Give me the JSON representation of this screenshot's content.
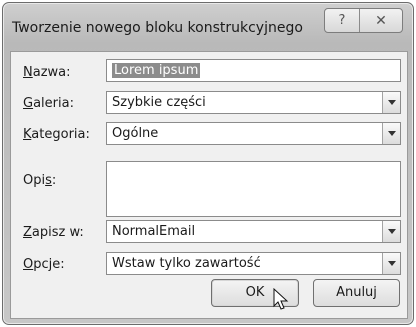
{
  "window": {
    "title": "Tworzenie nowego bloku konstrukcyjnego",
    "help_label": "?",
    "close_label": "✕"
  },
  "form": {
    "name": {
      "label": "Nazwa:",
      "accesskey": "N",
      "value": "Lorem ipsum"
    },
    "gallery": {
      "label": "Galeria:",
      "accesskey": "G",
      "value": "Szybkie części"
    },
    "category": {
      "label": "Kategoria:",
      "accesskey": "K",
      "value": "Ogólne"
    },
    "description": {
      "label": "Opis:",
      "accesskey": "s",
      "value": ""
    },
    "save_in": {
      "label": "Zapisz w:",
      "accesskey": "Z",
      "value": "NormalEmail"
    },
    "options": {
      "label": "Opcje:",
      "accesskey": "O",
      "value": "Wstaw tylko zawartość"
    }
  },
  "buttons": {
    "ok": "OK",
    "cancel": "Anuluj"
  }
}
